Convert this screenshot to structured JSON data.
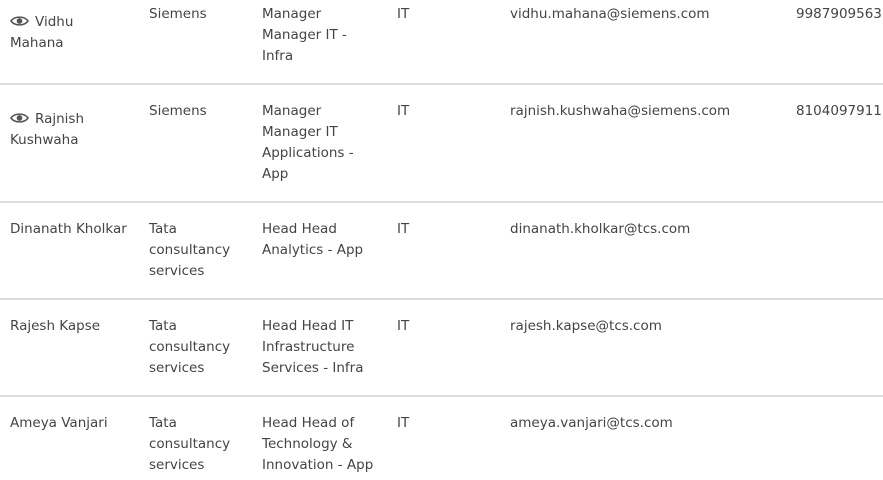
{
  "icons": {
    "view": "eye-icon"
  },
  "rows": [
    {
      "name_line1": "Vidhu",
      "name_line2": "Mahana",
      "company": [
        "Siemens"
      ],
      "designation": [
        "Manager",
        "Manager IT -",
        "Infra"
      ],
      "department": "IT",
      "email": "vidhu.mahana@siemens.com",
      "phone": "9987909563"
    },
    {
      "name_line1": "Rajnish",
      "name_line2": "Kushwaha",
      "company": [
        "Siemens"
      ],
      "designation": [
        "Manager",
        "Manager IT",
        "Applications -",
        "App"
      ],
      "department": "IT",
      "email": "rajnish.kushwaha@siemens.com",
      "phone": "8104097911"
    },
    {
      "name_line1": "Dinanath Kholkar",
      "company": [
        "Tata",
        "consultancy",
        "services"
      ],
      "designation": [
        "Head Head",
        "Analytics - App"
      ],
      "department": "IT",
      "email": "dinanath.kholkar@tcs.com"
    },
    {
      "name_line1": "Rajesh Kapse",
      "company": [
        "Tata",
        "consultancy",
        "services"
      ],
      "designation": [
        "Head Head IT",
        "Infrastructure",
        "Services - Infra"
      ],
      "department": "IT",
      "email": "rajesh.kapse@tcs.com"
    },
    {
      "name_line1": "Ameya Vanjari",
      "company": [
        "Tata",
        "consultancy",
        "services"
      ],
      "designation": [
        "Head Head of",
        "Technology &",
        "Innovation - App"
      ],
      "department": "IT",
      "email": "ameya.vanjari@tcs.com"
    }
  ]
}
